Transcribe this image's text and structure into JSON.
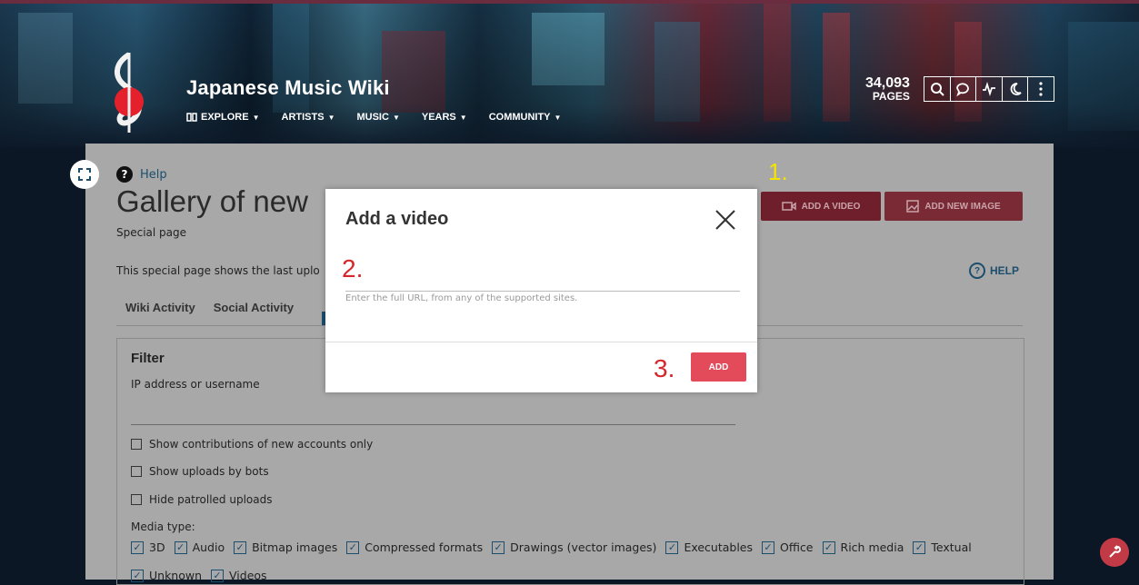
{
  "header": {
    "wiki_name": "Japanese Music Wiki",
    "nav": [
      "EXPLORE",
      "ARTISTS",
      "MUSIC",
      "YEARS",
      "COMMUNITY"
    ],
    "pages_count": "34,093",
    "pages_label": "PAGES",
    "tool_icons": [
      "search-icon",
      "discussions-icon",
      "activity-icon",
      "dark-mode-icon",
      "more-icon"
    ]
  },
  "page": {
    "help_label": "Help",
    "title": "Gallery of new",
    "subtitle": "Special page",
    "intro": "This special page shows the last uplo",
    "add_video_label": "ADD A VIDEO",
    "add_image_label": "ADD NEW IMAGE",
    "help_right_label": "HELP",
    "tabs": [
      "Wiki Activity",
      "Social Activity"
    ],
    "filter": {
      "title": "Filter",
      "ip_label": "IP address or username",
      "checkboxes": [
        "Show contributions of new accounts only",
        "Show uploads by bots",
        "Hide patrolled uploads"
      ],
      "media_type_label": "Media type:",
      "media_types": [
        "3D",
        "Audio",
        "Bitmap images",
        "Compressed formats",
        "Drawings (vector images)",
        "Executables",
        "Office",
        "Rich media",
        "Textual"
      ],
      "media_types_row2": [
        "Unknown",
        "Videos"
      ]
    }
  },
  "modal": {
    "title": "Add a video",
    "url_value": "",
    "hint": "Enter the full URL, from any of the supported sites.",
    "add_label": "ADD"
  },
  "annotations": {
    "step1": "1.",
    "step2": "2.",
    "step3": "3."
  },
  "colors": {
    "accent": "#e34a5a",
    "link": "#1c4e6e",
    "annotation_yellow": "#f4e400",
    "annotation_red": "#d6262b"
  }
}
